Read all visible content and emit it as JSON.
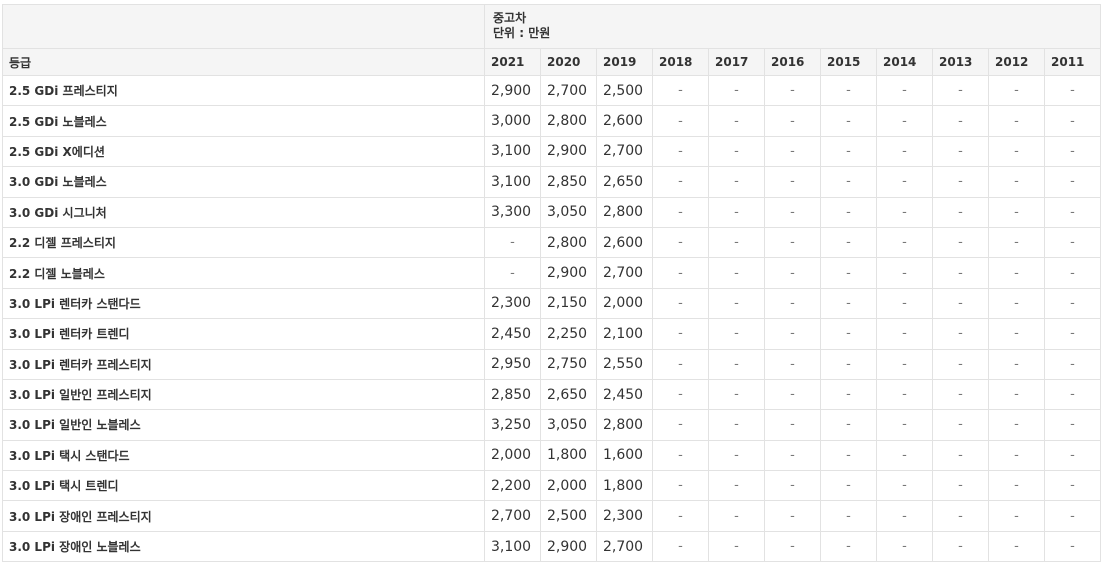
{
  "header": {
    "note_line1": "중고차",
    "note_line2": "단위 : 만원",
    "grade_label": "등급"
  },
  "years": [
    "2021",
    "2020",
    "2019",
    "2018",
    "2017",
    "2016",
    "2015",
    "2014",
    "2013",
    "2012",
    "2011"
  ],
  "rows": [
    {
      "grade": "2.5 GDi 프레스티지",
      "values": [
        "2,900",
        "2,700",
        "2,500",
        "-",
        "-",
        "-",
        "-",
        "-",
        "-",
        "-",
        "-"
      ]
    },
    {
      "grade": "2.5 GDi 노블레스",
      "values": [
        "3,000",
        "2,800",
        "2,600",
        "-",
        "-",
        "-",
        "-",
        "-",
        "-",
        "-",
        "-"
      ]
    },
    {
      "grade": "2.5 GDi X에디션",
      "values": [
        "3,100",
        "2,900",
        "2,700",
        "-",
        "-",
        "-",
        "-",
        "-",
        "-",
        "-",
        "-"
      ]
    },
    {
      "grade": "3.0 GDi 노블레스",
      "values": [
        "3,100",
        "2,850",
        "2,650",
        "-",
        "-",
        "-",
        "-",
        "-",
        "-",
        "-",
        "-"
      ]
    },
    {
      "grade": "3.0 GDi 시그니처",
      "values": [
        "3,300",
        "3,050",
        "2,800",
        "-",
        "-",
        "-",
        "-",
        "-",
        "-",
        "-",
        "-"
      ]
    },
    {
      "grade": "2.2 디젤 프레스티지",
      "values": [
        "-",
        "2,800",
        "2,600",
        "-",
        "-",
        "-",
        "-",
        "-",
        "-",
        "-",
        "-"
      ]
    },
    {
      "grade": "2.2 디젤 노블레스",
      "values": [
        "-",
        "2,900",
        "2,700",
        "-",
        "-",
        "-",
        "-",
        "-",
        "-",
        "-",
        "-"
      ]
    },
    {
      "grade": "3.0 LPi 렌터카 스탠다드",
      "values": [
        "2,300",
        "2,150",
        "2,000",
        "-",
        "-",
        "-",
        "-",
        "-",
        "-",
        "-",
        "-"
      ]
    },
    {
      "grade": "3.0 LPi 렌터카 트렌디",
      "values": [
        "2,450",
        "2,250",
        "2,100",
        "-",
        "-",
        "-",
        "-",
        "-",
        "-",
        "-",
        "-"
      ]
    },
    {
      "grade": "3.0 LPi 렌터카 프레스티지",
      "values": [
        "2,950",
        "2,750",
        "2,550",
        "-",
        "-",
        "-",
        "-",
        "-",
        "-",
        "-",
        "-"
      ]
    },
    {
      "grade": "3.0 LPi 일반인 프레스티지",
      "values": [
        "2,850",
        "2,650",
        "2,450",
        "-",
        "-",
        "-",
        "-",
        "-",
        "-",
        "-",
        "-"
      ]
    },
    {
      "grade": "3.0 LPi 일반인 노블레스",
      "values": [
        "3,250",
        "3,050",
        "2,800",
        "-",
        "-",
        "-",
        "-",
        "-",
        "-",
        "-",
        "-"
      ]
    },
    {
      "grade": "3.0 LPi 택시 스탠다드",
      "values": [
        "2,000",
        "1,800",
        "1,600",
        "-",
        "-",
        "-",
        "-",
        "-",
        "-",
        "-",
        "-"
      ]
    },
    {
      "grade": "3.0 LPi 택시 트렌디",
      "values": [
        "2,200",
        "2,000",
        "1,800",
        "-",
        "-",
        "-",
        "-",
        "-",
        "-",
        "-",
        "-"
      ]
    },
    {
      "grade": "3.0 LPi 장애인 프레스티지",
      "values": [
        "2,700",
        "2,500",
        "2,300",
        "-",
        "-",
        "-",
        "-",
        "-",
        "-",
        "-",
        "-"
      ]
    },
    {
      "grade": "3.0 LPi 장애인 노블레스",
      "values": [
        "3,100",
        "2,900",
        "2,700",
        "-",
        "-",
        "-",
        "-",
        "-",
        "-",
        "-",
        "-"
      ]
    }
  ]
}
